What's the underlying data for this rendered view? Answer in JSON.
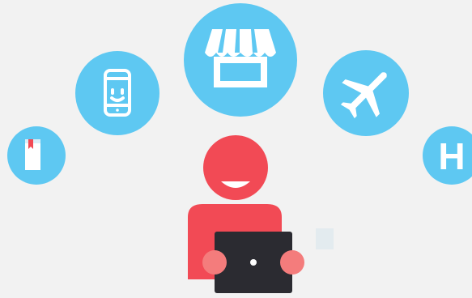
{
  "colors": {
    "background": "#f2f2f2",
    "circle": "#5ec8f2",
    "person": "#f24a55",
    "hands": "#f47c7c",
    "laptop": "#2b2b31",
    "icon": "#ffffff"
  },
  "circles": [
    {
      "id": "book",
      "icon": "book-icon",
      "label": ""
    },
    {
      "id": "phone",
      "icon": "smartphone-icon",
      "label": ""
    },
    {
      "id": "shop",
      "icon": "storefront-icon",
      "label": ""
    },
    {
      "id": "plane",
      "icon": "airplane-icon",
      "label": ""
    },
    {
      "id": "hotel",
      "icon": "hotel-letter-icon",
      "label": "H"
    }
  ],
  "person": {
    "icon": "person-with-laptop"
  }
}
